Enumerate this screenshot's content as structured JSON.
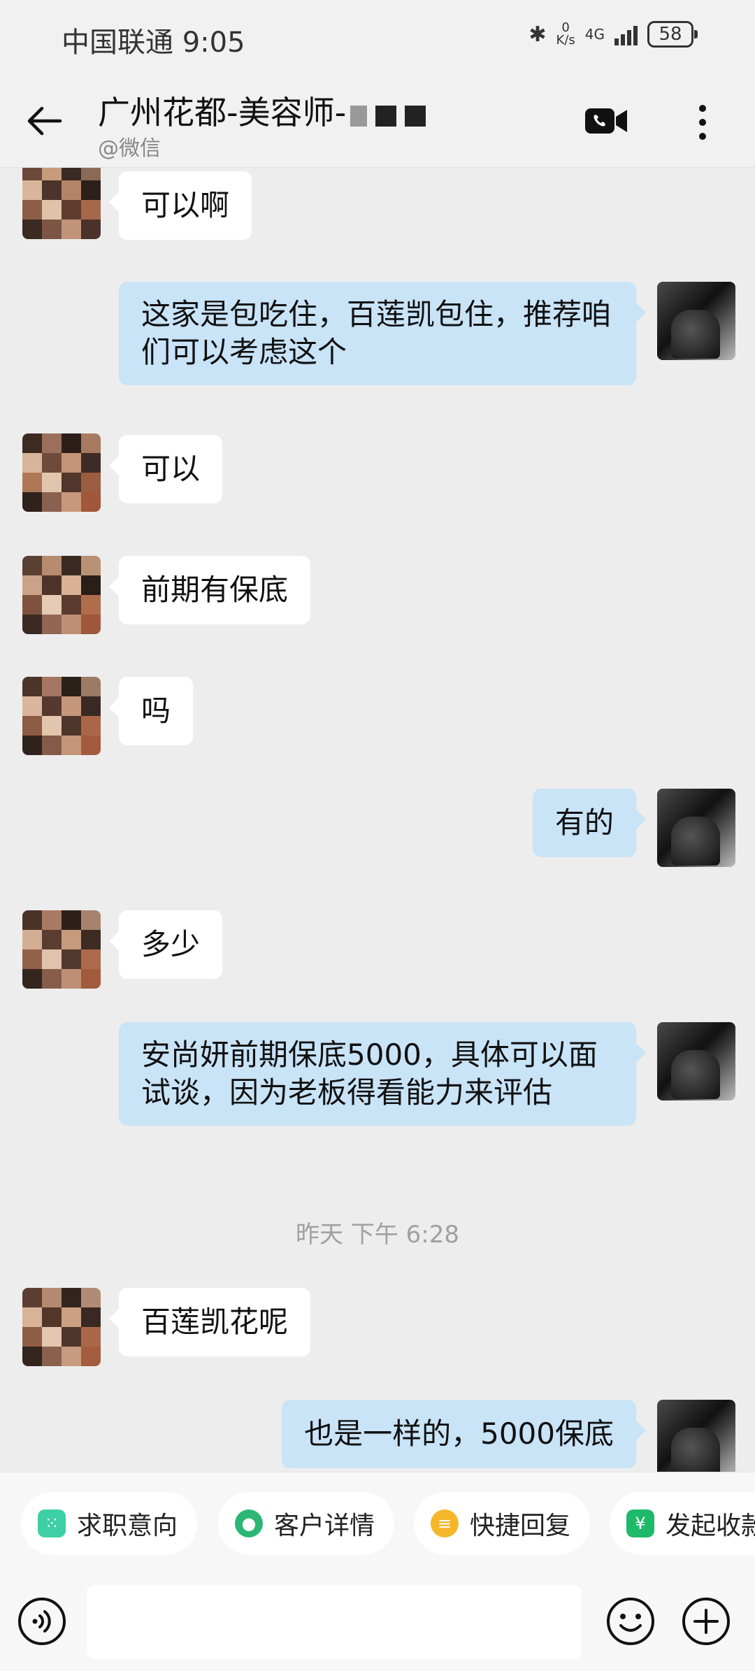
{
  "status_bar": {
    "carrier": "中国联通",
    "time": "9:05",
    "netspeed_value": "0",
    "netspeed_unit": "K/s",
    "network": "4G",
    "battery": "58"
  },
  "header": {
    "title": "广州花都-美容师-",
    "subtitle": "@微信"
  },
  "messages": [
    {
      "from": "other",
      "text": "可以啊"
    },
    {
      "from": "me",
      "text": "这家是包吃住，百莲凯包住，推荐咱们可以考虑这个"
    },
    {
      "from": "other",
      "text": "可以"
    },
    {
      "from": "other",
      "text": "前期有保底"
    },
    {
      "from": "other",
      "text": "吗"
    },
    {
      "from": "me",
      "text": "有的"
    },
    {
      "from": "other",
      "text": "多少"
    },
    {
      "from": "me",
      "text": "安尚妍前期保底5000，具体可以面试谈，因为老板得看能力来评估"
    },
    {
      "from": "other",
      "text": "百莲凯花呢"
    },
    {
      "from": "me",
      "text": "也是一样的，5000保底"
    }
  ],
  "timestamp": "昨天  下午 6:28",
  "quick_actions": [
    {
      "label": "求职意向",
      "icon": "job-intent-icon",
      "color": "#3ecfa5"
    },
    {
      "label": "客户详情",
      "icon": "customer-icon",
      "color": "#2bb673"
    },
    {
      "label": "快捷回复",
      "icon": "quick-reply-icon",
      "color": "#f5b72a"
    },
    {
      "label": "发起收款",
      "icon": "payment-icon",
      "color": "#1fb96a"
    }
  ],
  "input": {
    "placeholder": ""
  }
}
